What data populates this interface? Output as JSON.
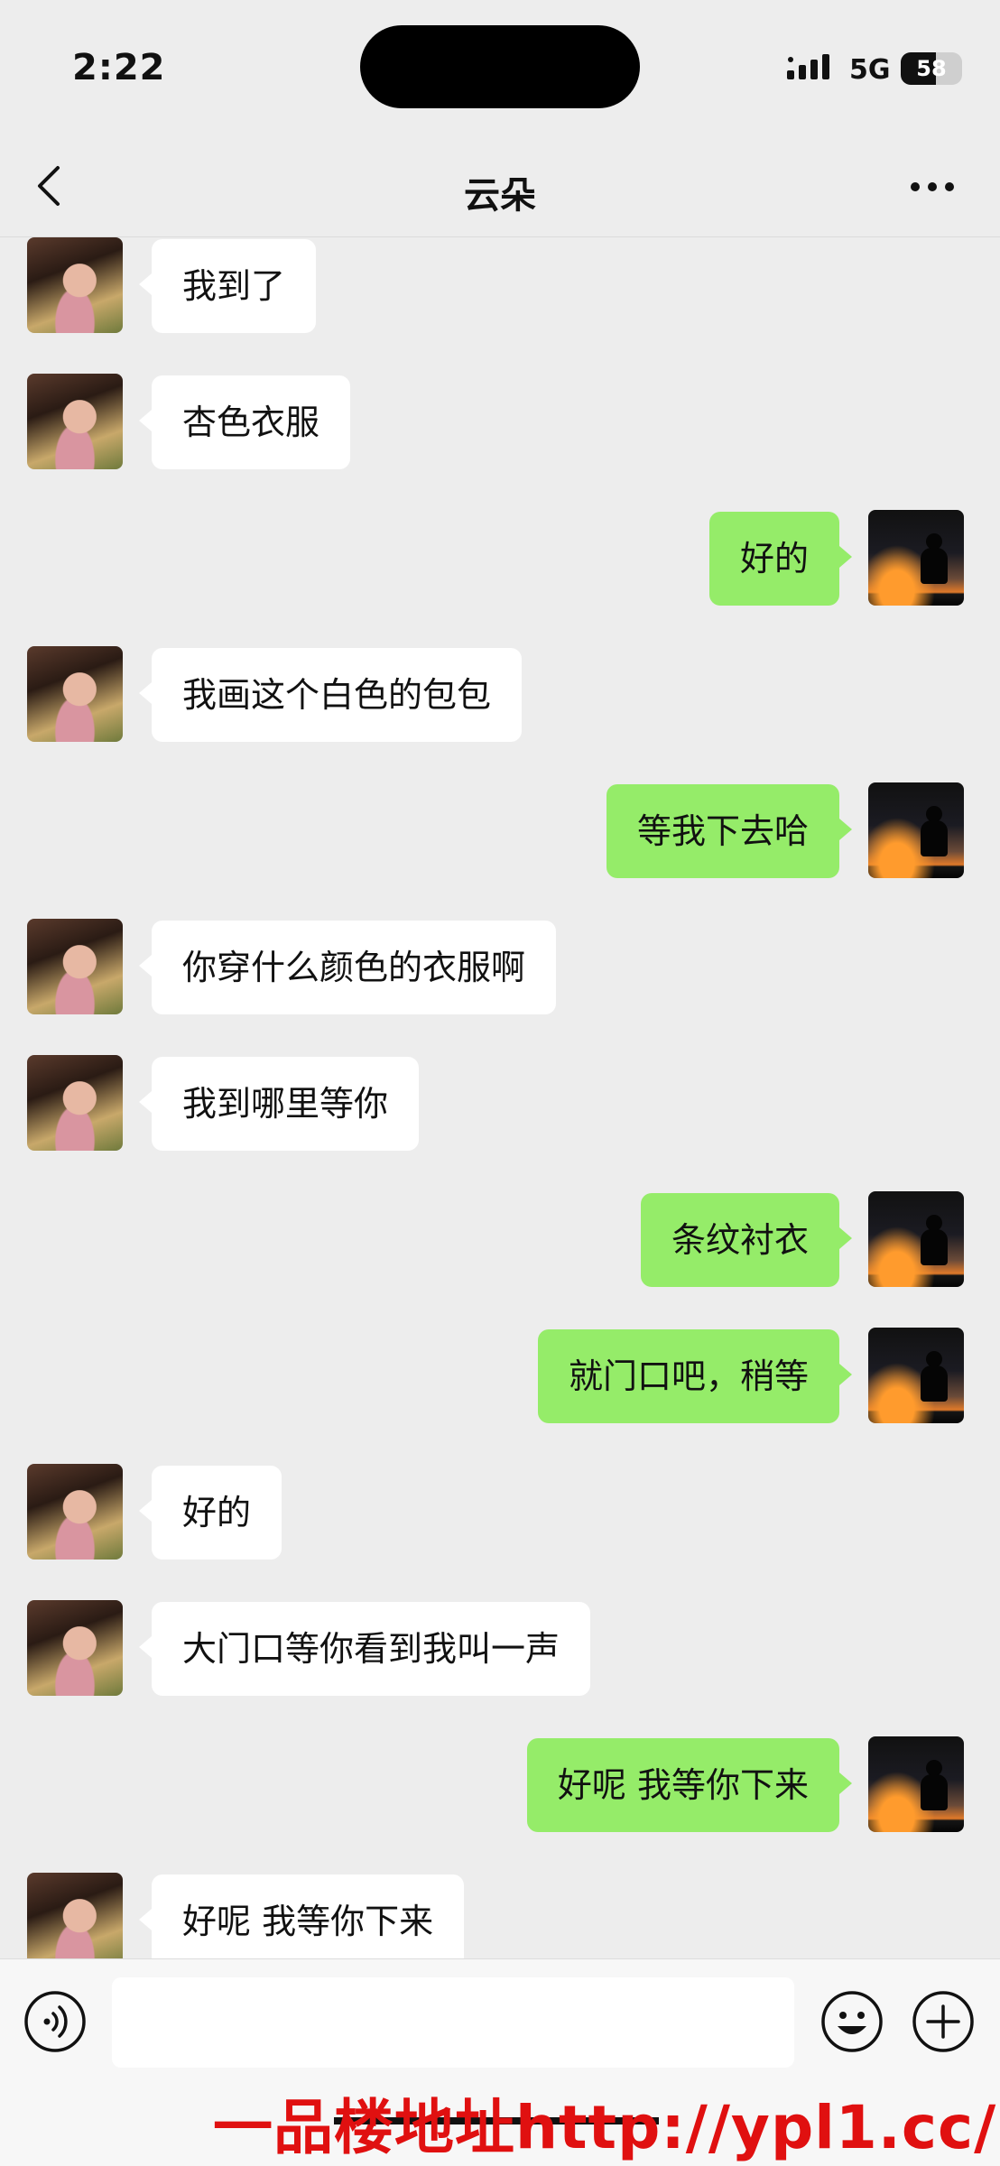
{
  "status_bar": {
    "time": "2:22",
    "network": "5G",
    "battery_level": 58,
    "battery_text": "58"
  },
  "nav": {
    "title": "云朵"
  },
  "messages": [
    {
      "side": "left",
      "text": "我到了"
    },
    {
      "side": "left",
      "text": "杏色衣服"
    },
    {
      "side": "right",
      "text": "好的"
    },
    {
      "side": "left",
      "text": "我画这个白色的包包"
    },
    {
      "side": "right",
      "text": "等我下去哈"
    },
    {
      "side": "left",
      "text": "你穿什么颜色的衣服啊"
    },
    {
      "side": "left",
      "text": "我到哪里等你"
    },
    {
      "side": "right",
      "text": "条纹衬衣"
    },
    {
      "side": "right",
      "text": "就门口吧，稍等"
    },
    {
      "side": "left",
      "text": "好的"
    },
    {
      "side": "left",
      "text": "大门口等你看到我叫一声"
    },
    {
      "side": "right",
      "text": "好呢 我等你下来"
    },
    {
      "side": "left",
      "text": "好呢 我等你下来"
    }
  ],
  "input": {
    "value": "",
    "placeholder": ""
  },
  "watermark": {
    "text": "一品楼地址http://ypl1.cc/"
  },
  "colors": {
    "background": "#ededed",
    "sent_bubble": "#95ec69",
    "received_bubble": "#ffffff",
    "watermark": "#e01010"
  },
  "icons": {
    "back": "chevron-left-icon",
    "more": "more-dots-icon",
    "voice": "voice-icon",
    "emoji": "emoji-icon",
    "plus": "plus-icon"
  }
}
